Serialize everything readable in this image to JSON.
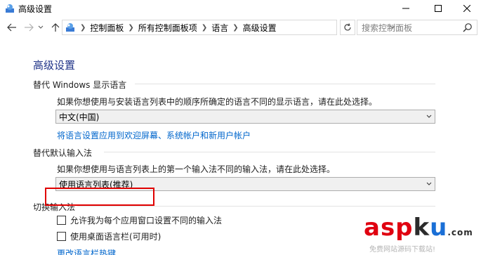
{
  "window": {
    "title": "高级设置"
  },
  "address_bar": {
    "breadcrumbs": [
      "控制面板",
      "所有控制面板项",
      "语言",
      "高级设置"
    ],
    "search_placeholder": "搜索控制面板"
  },
  "page": {
    "title": "高级设置",
    "display_language": {
      "section_title": "替代 Windows 显示语言",
      "description": "如果你想使用与安装语言列表中的顺序所确定的语言不同的显示语言，请在此处选择。",
      "selected": "中文(中国)",
      "link": "将语言设置应用到欢迎屏幕、系统帐户和新用户帐户"
    },
    "input_method": {
      "section_title": "替代默认输入法",
      "description": "如果你想使用与语言列表上的第一个输入法不同的输入法，请在此处选择。",
      "selected": "使用语言列表(推荐)"
    },
    "switch_input": {
      "section_title": "切换输入法",
      "option_per_app": "允许我为每个应用窗口设置不同的输入法",
      "option_language_bar": "使用桌面语言栏(可用时)",
      "link_hotkeys": "更改语言栏热键"
    }
  },
  "watermark": {
    "logo_part1": "asp",
    "logo_part2": "k",
    "logo_part3": "u",
    "logo_suffix": ".com",
    "subtitle": "免费网站源码下载站!"
  },
  "colors": {
    "title_blue": "#1e3287",
    "link_blue": "#0066cc",
    "highlight_red": "#e00000"
  }
}
